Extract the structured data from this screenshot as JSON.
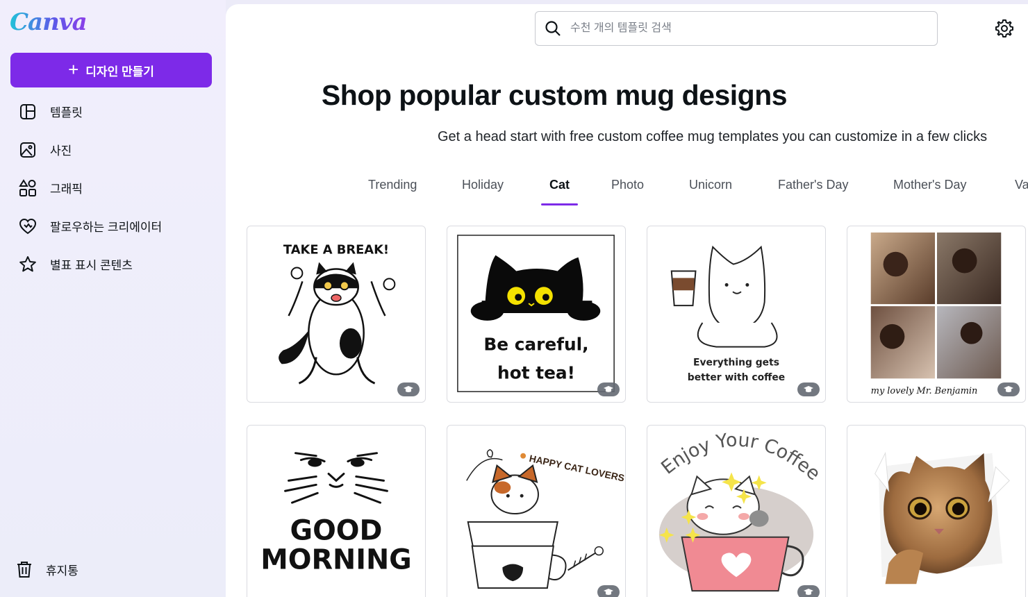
{
  "sidebar": {
    "logo": "Canva",
    "create_label": "디자인 만들기",
    "items": [
      {
        "label": "템플릿",
        "icon": "template-icon"
      },
      {
        "label": "사진",
        "icon": "photo-icon"
      },
      {
        "label": "그래픽",
        "icon": "shapes-icon"
      },
      {
        "label": "팔로우하는 크리에이터",
        "icon": "heart-icon"
      },
      {
        "label": "별표 표시 콘텐츠",
        "icon": "star-icon"
      }
    ],
    "trash_label": "휴지통"
  },
  "search": {
    "placeholder": "수천 개의 템플릿 검색"
  },
  "page": {
    "headline": "Shop popular custom mug designs",
    "subhead": "Get a head start with free custom coffee mug templates you can customize in a few clicks"
  },
  "tabs": [
    "Trending",
    "Holiday",
    "Cat",
    "Photo",
    "Unicorn",
    "Father's Day",
    "Mother's Day",
    "Va"
  ],
  "active_tab": "Cat",
  "cards": [
    {
      "text": [
        "TAKE A BREAK!"
      ],
      "desc": "cat-dancing"
    },
    {
      "text": [
        "Be careful,",
        "hot tea!"
      ],
      "desc": "black-cat-peeking"
    },
    {
      "text": [
        "Everything gets",
        "better with coffee"
      ],
      "desc": "cat-holding-coffee"
    },
    {
      "text": [
        "my lovely Mr. Benjamin"
      ],
      "desc": "photo-collage"
    },
    {
      "text": [
        "GOOD",
        "MORNING"
      ],
      "desc": "grumpy-cat-face"
    },
    {
      "text": [
        "HAPPY CAT LOVERS"
      ],
      "desc": "cat-in-cups"
    },
    {
      "text": [
        "Enjoy Your Coffee"
      ],
      "desc": "cat-in-pink-cup"
    },
    {
      "text": [],
      "desc": "cat-peeking-paper"
    }
  ],
  "colors": {
    "accent": "#7d2ae8",
    "pro_badge": "#646a73"
  }
}
